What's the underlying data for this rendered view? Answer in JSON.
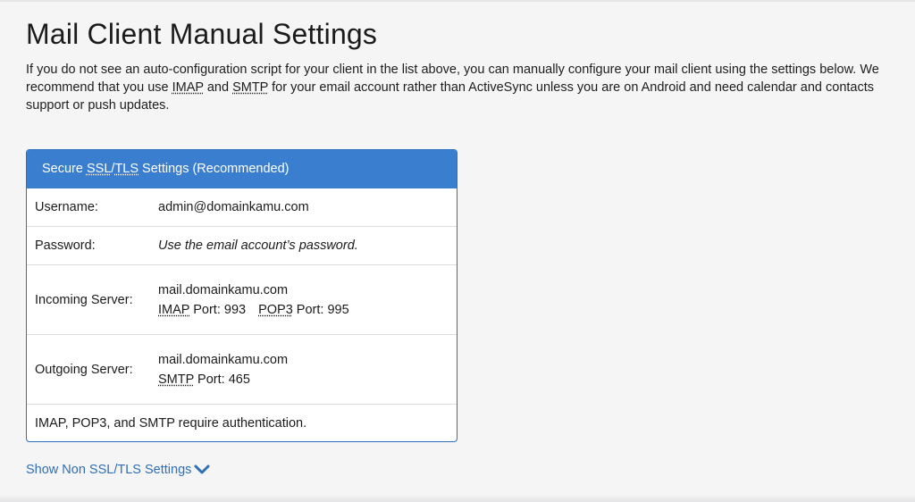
{
  "page": {
    "title": "Mail Client Manual Settings",
    "intro": {
      "p1": "If you do not see an auto-configuration script for your client in the list above, you can manually configure your mail client using the settings below. We recommend that you use ",
      "imap": "IMAP",
      "and": " and ",
      "smtp": "SMTP",
      "p2": " for your email account rather than ActiveSync unless you are on Android and need calendar and contacts support or push updates."
    }
  },
  "panel": {
    "header": {
      "prefix": "Secure ",
      "ssl": "SSL",
      "slash": "/",
      "tls": "TLS",
      "suffix": " Settings (Recommended)"
    },
    "username": {
      "label": "Username:",
      "value": "admin@domainkamu.com"
    },
    "password": {
      "label": "Password:",
      "value": "Use the email account’s password."
    },
    "incoming": {
      "label": "Incoming Server:",
      "host": "mail.domainkamu.com",
      "imap": "IMAP",
      "imap_port": " Port: 993",
      "pop3": "POP3",
      "pop3_port": " Port: 995"
    },
    "outgoing": {
      "label": "Outgoing Server:",
      "host": "mail.domainkamu.com",
      "smtp": "SMTP",
      "smtp_port": " Port: 465"
    },
    "note": "IMAP, POP3, and SMTP require authentication."
  },
  "toggle": {
    "label": "Show Non SSL/TLS Settings",
    "icon": "chevron-down-icon"
  },
  "colors": {
    "accent": "#3a7ecf",
    "link": "#2f6fb5",
    "background": "#f5f5f6"
  }
}
